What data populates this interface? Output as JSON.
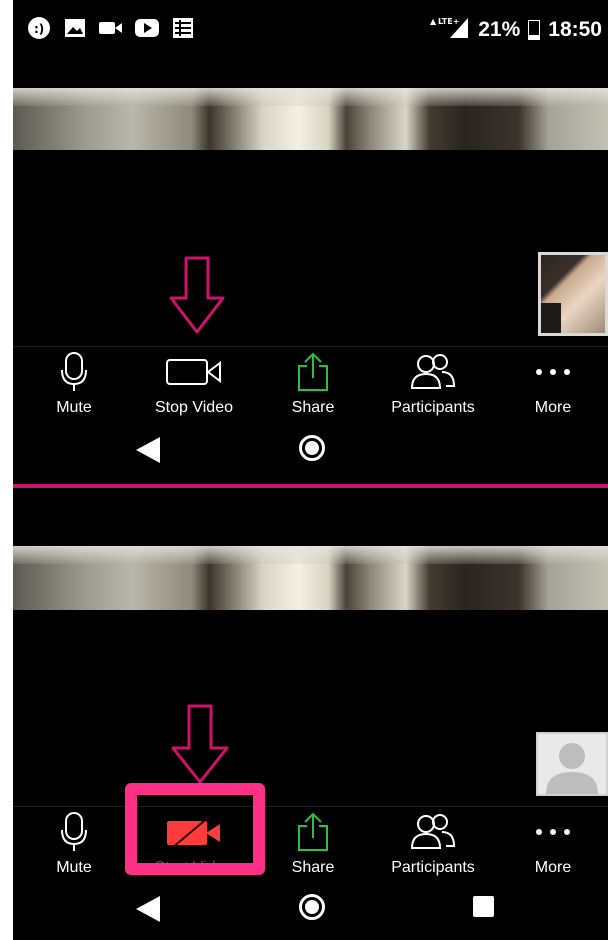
{
  "status_bar": {
    "battery_percent": "21%",
    "time": "18:50",
    "network": "LTE+",
    "battery_level": 0.21,
    "notification_icons": [
      "chat-bubble-icon",
      "image-icon",
      "video-camera-icon",
      "youtube-icon",
      "app-icon"
    ]
  },
  "screens": [
    {
      "state": "video-on",
      "toolbar": {
        "mute_label": "Mute",
        "video_label": "Stop Video",
        "share_label": "Share",
        "participants_label": "Participants",
        "more_label": "More"
      }
    },
    {
      "state": "video-off",
      "toolbar": {
        "mute_label": "Mute",
        "video_label": "Start Video",
        "share_label": "Share",
        "participants_label": "Participants",
        "more_label": "More"
      }
    }
  ],
  "colors": {
    "annotation_pink": "#d0116b",
    "highlight_pink": "#ff2f86",
    "share_green": "#2fbf3a",
    "video_off_red": "#ff3b3b"
  }
}
